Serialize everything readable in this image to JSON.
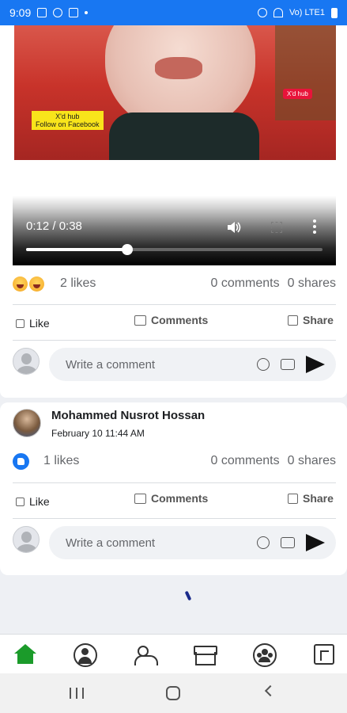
{
  "status_bar": {
    "time": "9:09",
    "signal": "Vo) LTE1"
  },
  "video_overlay": {
    "watermark_line1": "X'd hub",
    "watermark_line2": "Follow on Facebook",
    "watermark_tag": "X'd hub"
  },
  "video_player": {
    "time_display": "0:12 / 0:38",
    "progress_fraction": 0.34
  },
  "post1": {
    "likes": "2 likes",
    "comments": "0 comments",
    "shares": "0 shares",
    "like_label": "Like",
    "comments_label": "Comments",
    "share_label": "Share",
    "comment_placeholder": "Write a comment"
  },
  "post2": {
    "author": "Mohammed Nusrot Hossan",
    "date": "February 10 11:44 AM",
    "likes": "1 likes",
    "comments": "0 comments",
    "shares": "0 shares",
    "like_label": "Like",
    "comments_label": "Comments",
    "share_label": "Share",
    "comment_placeholder": "Write a comment"
  },
  "bottom_nav": {
    "items": [
      "home-icon",
      "profile-icon",
      "friends-icon",
      "marketplace-icon",
      "groups-icon",
      "pages-icon"
    ],
    "active": "home-icon",
    "active_color": "#1b9b2a"
  },
  "colors": {
    "brand": "#1877f2",
    "like_bubble": "#1877f2"
  }
}
